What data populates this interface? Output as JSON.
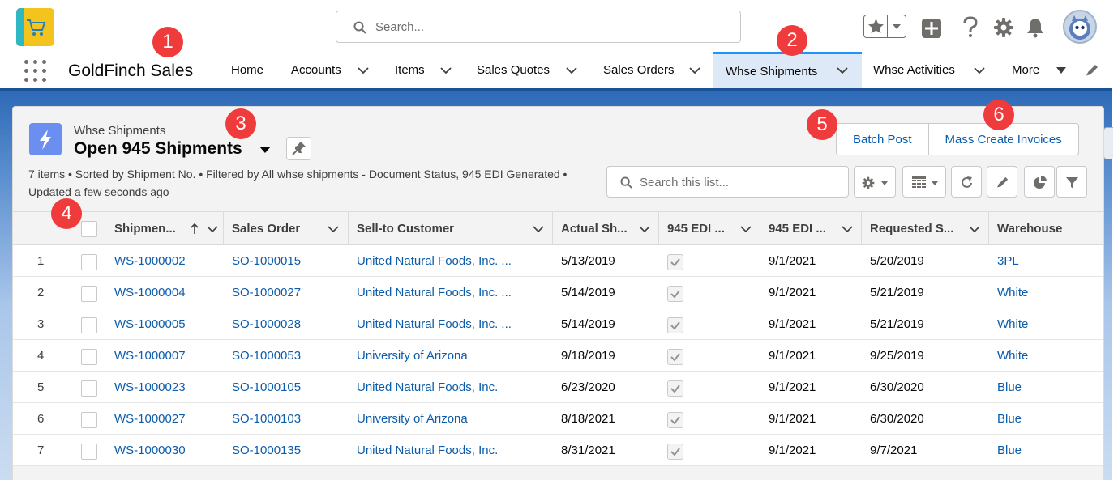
{
  "header": {
    "search_placeholder": "Search...",
    "icons": [
      "star-icon",
      "chevron-down-icon",
      "add-icon",
      "help-icon",
      "setup-gear-icon",
      "notification-bell-icon",
      "avatar"
    ]
  },
  "nav": {
    "app_name": "GoldFinch Sales",
    "items": [
      {
        "label": "Home"
      },
      {
        "label": "Accounts"
      },
      {
        "label": "Items"
      },
      {
        "label": "Sales Quotes"
      },
      {
        "label": "Sales Orders"
      },
      {
        "label": "Whse Shipments",
        "active": true
      },
      {
        "label": "Whse Activities"
      },
      {
        "label": "More"
      }
    ]
  },
  "list_view": {
    "object_label": "Whse Shipments",
    "title": "Open 945 Shipments",
    "info_line": "7 items • Sorted by Shipment No. • Filtered by All whse shipments - Document Status, 945 EDI Generated • Updated a few seconds ago",
    "buttons": {
      "batch_post": "Batch Post",
      "mass_create_invoices": "Mass Create Invoices"
    },
    "search_placeholder": "Search this list...",
    "columns": [
      "Shipmen...",
      "Sales Order",
      "Sell-to Customer",
      "Actual Sh...",
      "945 EDI ...",
      "945 EDI ...",
      "Requested S...",
      "Warehouse"
    ],
    "rows": [
      {
        "num": "1",
        "shipment": "WS-1000002",
        "order": "SO-1000015",
        "customer": "United Natural Foods, Inc. ...",
        "actual": "5/13/2019",
        "edi_checked": true,
        "edi_date": "9/1/2021",
        "requested": "5/20/2019",
        "warehouse": "3PL"
      },
      {
        "num": "2",
        "shipment": "WS-1000004",
        "order": "SO-1000027",
        "customer": "United Natural Foods, Inc. ...",
        "actual": "5/14/2019",
        "edi_checked": true,
        "edi_date": "9/1/2021",
        "requested": "5/21/2019",
        "warehouse": "White"
      },
      {
        "num": "3",
        "shipment": "WS-1000005",
        "order": "SO-1000028",
        "customer": "United Natural Foods, Inc. ...",
        "actual": "5/14/2019",
        "edi_checked": true,
        "edi_date": "9/1/2021",
        "requested": "5/21/2019",
        "warehouse": "White"
      },
      {
        "num": "4",
        "shipment": "WS-1000007",
        "order": "SO-1000053",
        "customer": "University of Arizona",
        "actual": "9/18/2019",
        "edi_checked": true,
        "edi_date": "9/1/2021",
        "requested": "9/25/2019",
        "warehouse": "White"
      },
      {
        "num": "5",
        "shipment": "WS-1000023",
        "order": "SO-1000105",
        "customer": "United Natural Foods, Inc.",
        "actual": "6/23/2020",
        "edi_checked": true,
        "edi_date": "9/1/2021",
        "requested": "6/30/2020",
        "warehouse": "Blue"
      },
      {
        "num": "6",
        "shipment": "WS-1000027",
        "order": "SO-1000103",
        "customer": "University of Arizona",
        "actual": "8/18/2021",
        "edi_checked": true,
        "edi_date": "9/1/2021",
        "requested": "6/30/2020",
        "warehouse": "Blue"
      },
      {
        "num": "7",
        "shipment": "WS-1000030",
        "order": "SO-1000135",
        "customer": "United Natural Foods, Inc.",
        "actual": "8/31/2021",
        "edi_checked": true,
        "edi_date": "9/1/2021",
        "requested": "9/7/2021",
        "warehouse": "Blue"
      }
    ]
  },
  "callouts": [
    "1",
    "2",
    "3",
    "4",
    "5",
    "6"
  ],
  "colors": {
    "brand_blue": "#1b5297",
    "link": "#0b5cab",
    "callout_red": "#ef3b3b",
    "object_icon": "#6a8ff1",
    "active_tab": "#dde9f7"
  }
}
